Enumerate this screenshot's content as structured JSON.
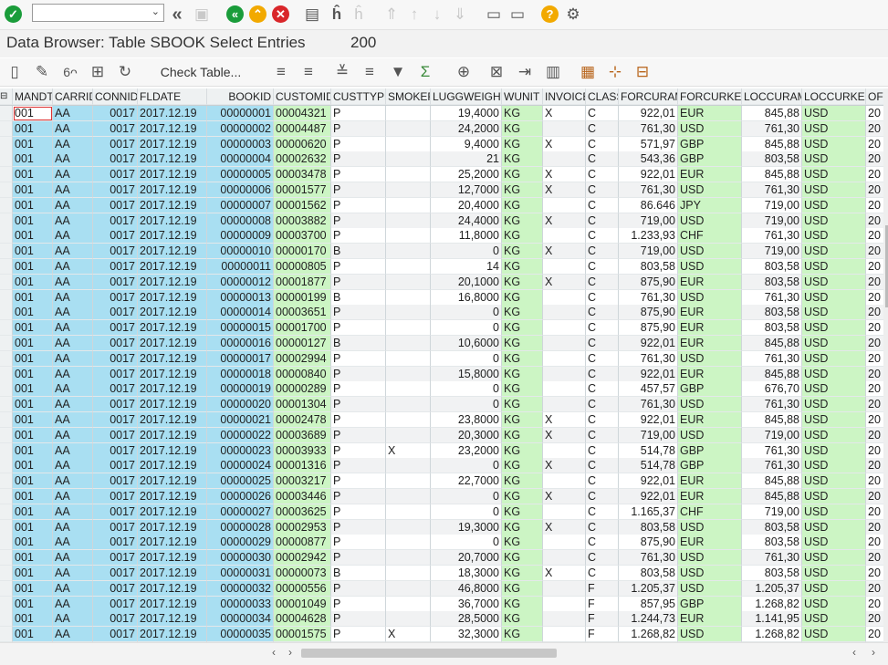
{
  "title": "Data Browser: Table SBOOK Select Entries",
  "entries_count": "200",
  "toolbar": {
    "check_table_label": "Check Table...",
    "icons": [
      "confirm-icon",
      "command-field",
      "back-double-icon",
      "save-icon",
      "back-icon",
      "exit-icon",
      "cancel-icon",
      "print-icon",
      "find-icon",
      "find-next-icon",
      "first-page-icon",
      "previous-page-icon",
      "next-page-icon",
      "last-page-icon",
      "new-session-icon",
      "shortcut-icon",
      "help-icon",
      "settings-icon",
      "new-entry-icon",
      "edit-icon",
      "display-icon",
      "check-icon",
      "refresh-icon",
      "sort-ascending-icon",
      "sort-descending-icon",
      "filter-icon",
      "sum-icon",
      "print-view-icon",
      "export-excel-icon",
      "export-icon",
      "layout-icon",
      "grid-icon",
      "calculator-icon",
      "local-file-icon"
    ]
  },
  "table": {
    "columns": [
      "MANDT",
      "CARRID",
      "CONNID",
      "FLDATE",
      "BOOKID",
      "CUSTOMID",
      "CUSTTYPE",
      "SMOKER",
      "LUGGWEIGHT",
      "WUNIT",
      "INVOICE",
      "CLASS",
      "FORCURAM",
      "FORCURKEY",
      "LOCCURAM",
      "LOCCURKEY",
      "OF"
    ],
    "rows": [
      [
        "001",
        "AA",
        "0017",
        "2017.12.19",
        "00000001",
        "00004321",
        "P",
        "",
        "19,4000",
        "KG",
        "X",
        "C",
        "922,01",
        "EUR",
        "845,88",
        "USD",
        "20"
      ],
      [
        "001",
        "AA",
        "0017",
        "2017.12.19",
        "00000002",
        "00004487",
        "P",
        "",
        "24,2000",
        "KG",
        "",
        "C",
        "761,30",
        "USD",
        "761,30",
        "USD",
        "20"
      ],
      [
        "001",
        "AA",
        "0017",
        "2017.12.19",
        "00000003",
        "00000620",
        "P",
        "",
        "9,4000",
        "KG",
        "X",
        "C",
        "571,97",
        "GBP",
        "845,88",
        "USD",
        "20"
      ],
      [
        "001",
        "AA",
        "0017",
        "2017.12.19",
        "00000004",
        "00002632",
        "P",
        "",
        "21",
        "KG",
        "",
        "C",
        "543,36",
        "GBP",
        "803,58",
        "USD",
        "20"
      ],
      [
        "001",
        "AA",
        "0017",
        "2017.12.19",
        "00000005",
        "00003478",
        "P",
        "",
        "25,2000",
        "KG",
        "X",
        "C",
        "922,01",
        "EUR",
        "845,88",
        "USD",
        "20"
      ],
      [
        "001",
        "AA",
        "0017",
        "2017.12.19",
        "00000006",
        "00001577",
        "P",
        "",
        "12,7000",
        "KG",
        "X",
        "C",
        "761,30",
        "USD",
        "761,30",
        "USD",
        "20"
      ],
      [
        "001",
        "AA",
        "0017",
        "2017.12.19",
        "00000007",
        "00001562",
        "P",
        "",
        "20,4000",
        "KG",
        "",
        "C",
        "86.646",
        "JPY",
        "719,00",
        "USD",
        "20"
      ],
      [
        "001",
        "AA",
        "0017",
        "2017.12.19",
        "00000008",
        "00003882",
        "P",
        "",
        "24,4000",
        "KG",
        "X",
        "C",
        "719,00",
        "USD",
        "719,00",
        "USD",
        "20"
      ],
      [
        "001",
        "AA",
        "0017",
        "2017.12.19",
        "00000009",
        "00003700",
        "P",
        "",
        "11,8000",
        "KG",
        "",
        "C",
        "1.233,93",
        "CHF",
        "761,30",
        "USD",
        "20"
      ],
      [
        "001",
        "AA",
        "0017",
        "2017.12.19",
        "00000010",
        "00000170",
        "B",
        "",
        "0",
        "KG",
        "X",
        "C",
        "719,00",
        "USD",
        "719,00",
        "USD",
        "20"
      ],
      [
        "001",
        "AA",
        "0017",
        "2017.12.19",
        "00000011",
        "00000805",
        "P",
        "",
        "14",
        "KG",
        "",
        "C",
        "803,58",
        "USD",
        "803,58",
        "USD",
        "20"
      ],
      [
        "001",
        "AA",
        "0017",
        "2017.12.19",
        "00000012",
        "00001877",
        "P",
        "",
        "20,1000",
        "KG",
        "X",
        "C",
        "875,90",
        "EUR",
        "803,58",
        "USD",
        "20"
      ],
      [
        "001",
        "AA",
        "0017",
        "2017.12.19",
        "00000013",
        "00000199",
        "B",
        "",
        "16,8000",
        "KG",
        "",
        "C",
        "761,30",
        "USD",
        "761,30",
        "USD",
        "20"
      ],
      [
        "001",
        "AA",
        "0017",
        "2017.12.19",
        "00000014",
        "00003651",
        "P",
        "",
        "0",
        "KG",
        "",
        "C",
        "875,90",
        "EUR",
        "803,58",
        "USD",
        "20"
      ],
      [
        "001",
        "AA",
        "0017",
        "2017.12.19",
        "00000015",
        "00001700",
        "P",
        "",
        "0",
        "KG",
        "",
        "C",
        "875,90",
        "EUR",
        "803,58",
        "USD",
        "20"
      ],
      [
        "001",
        "AA",
        "0017",
        "2017.12.19",
        "00000016",
        "00000127",
        "B",
        "",
        "10,6000",
        "KG",
        "",
        "C",
        "922,01",
        "EUR",
        "845,88",
        "USD",
        "20"
      ],
      [
        "001",
        "AA",
        "0017",
        "2017.12.19",
        "00000017",
        "00002994",
        "P",
        "",
        "0",
        "KG",
        "",
        "C",
        "761,30",
        "USD",
        "761,30",
        "USD",
        "20"
      ],
      [
        "001",
        "AA",
        "0017",
        "2017.12.19",
        "00000018",
        "00000840",
        "P",
        "",
        "15,8000",
        "KG",
        "",
        "C",
        "922,01",
        "EUR",
        "845,88",
        "USD",
        "20"
      ],
      [
        "001",
        "AA",
        "0017",
        "2017.12.19",
        "00000019",
        "00000289",
        "P",
        "",
        "0",
        "KG",
        "",
        "C",
        "457,57",
        "GBP",
        "676,70",
        "USD",
        "20"
      ],
      [
        "001",
        "AA",
        "0017",
        "2017.12.19",
        "00000020",
        "00001304",
        "P",
        "",
        "0",
        "KG",
        "",
        "C",
        "761,30",
        "USD",
        "761,30",
        "USD",
        "20"
      ],
      [
        "001",
        "AA",
        "0017",
        "2017.12.19",
        "00000021",
        "00002478",
        "P",
        "",
        "23,8000",
        "KG",
        "X",
        "C",
        "922,01",
        "EUR",
        "845,88",
        "USD",
        "20"
      ],
      [
        "001",
        "AA",
        "0017",
        "2017.12.19",
        "00000022",
        "00003689",
        "P",
        "",
        "20,3000",
        "KG",
        "X",
        "C",
        "719,00",
        "USD",
        "719,00",
        "USD",
        "20"
      ],
      [
        "001",
        "AA",
        "0017",
        "2017.12.19",
        "00000023",
        "00003933",
        "P",
        "X",
        "23,2000",
        "KG",
        "",
        "C",
        "514,78",
        "GBP",
        "761,30",
        "USD",
        "20"
      ],
      [
        "001",
        "AA",
        "0017",
        "2017.12.19",
        "00000024",
        "00001316",
        "P",
        "",
        "0",
        "KG",
        "X",
        "C",
        "514,78",
        "GBP",
        "761,30",
        "USD",
        "20"
      ],
      [
        "001",
        "AA",
        "0017",
        "2017.12.19",
        "00000025",
        "00003217",
        "P",
        "",
        "22,7000",
        "KG",
        "",
        "C",
        "922,01",
        "EUR",
        "845,88",
        "USD",
        "20"
      ],
      [
        "001",
        "AA",
        "0017",
        "2017.12.19",
        "00000026",
        "00003446",
        "P",
        "",
        "0",
        "KG",
        "X",
        "C",
        "922,01",
        "EUR",
        "845,88",
        "USD",
        "20"
      ],
      [
        "001",
        "AA",
        "0017",
        "2017.12.19",
        "00000027",
        "00003625",
        "P",
        "",
        "0",
        "KG",
        "",
        "C",
        "1.165,37",
        "CHF",
        "719,00",
        "USD",
        "20"
      ],
      [
        "001",
        "AA",
        "0017",
        "2017.12.19",
        "00000028",
        "00002953",
        "P",
        "",
        "19,3000",
        "KG",
        "X",
        "C",
        "803,58",
        "USD",
        "803,58",
        "USD",
        "20"
      ],
      [
        "001",
        "AA",
        "0017",
        "2017.12.19",
        "00000029",
        "00000877",
        "P",
        "",
        "0",
        "KG",
        "",
        "C",
        "875,90",
        "EUR",
        "803,58",
        "USD",
        "20"
      ],
      [
        "001",
        "AA",
        "0017",
        "2017.12.19",
        "00000030",
        "00002942",
        "P",
        "",
        "20,7000",
        "KG",
        "",
        "C",
        "761,30",
        "USD",
        "761,30",
        "USD",
        "20"
      ],
      [
        "001",
        "AA",
        "0017",
        "2017.12.19",
        "00000031",
        "00000073",
        "B",
        "",
        "18,3000",
        "KG",
        "X",
        "C",
        "803,58",
        "USD",
        "803,58",
        "USD",
        "20"
      ],
      [
        "001",
        "AA",
        "0017",
        "2017.12.19",
        "00000032",
        "00000556",
        "P",
        "",
        "46,8000",
        "KG",
        "",
        "F",
        "1.205,37",
        "USD",
        "1.205,37",
        "USD",
        "20"
      ],
      [
        "001",
        "AA",
        "0017",
        "2017.12.19",
        "00000033",
        "00001049",
        "P",
        "",
        "36,7000",
        "KG",
        "",
        "F",
        "857,95",
        "GBP",
        "1.268,82",
        "USD",
        "20"
      ],
      [
        "001",
        "AA",
        "0017",
        "2017.12.19",
        "00000034",
        "00004628",
        "P",
        "",
        "28,5000",
        "KG",
        "",
        "F",
        "1.244,73",
        "EUR",
        "1.141,95",
        "USD",
        "20"
      ],
      [
        "001",
        "AA",
        "0017",
        "2017.12.19",
        "00000035",
        "00001575",
        "P",
        "X",
        "32,3000",
        "KG",
        "",
        "F",
        "1.268,82",
        "USD",
        "1.268,82",
        "USD",
        "20"
      ]
    ]
  },
  "colors": {
    "key_column": "#a9dff2",
    "alt_column": "#ccf5c4",
    "confirm": "#1a9c3a",
    "cancel": "#d9262a",
    "nav": "#f2a900"
  }
}
